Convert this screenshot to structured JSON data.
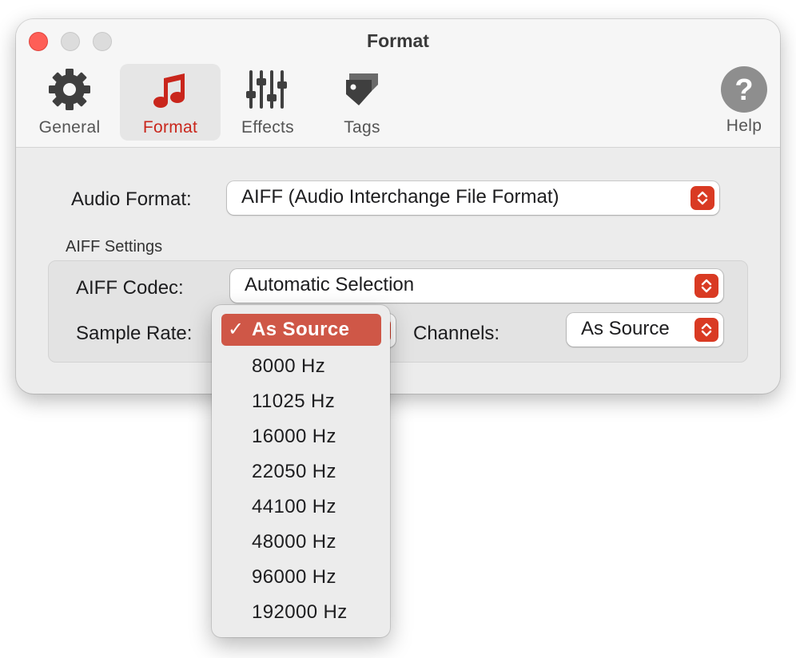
{
  "window": {
    "title": "Format"
  },
  "toolbar": {
    "items": [
      {
        "label": "General",
        "icon": "gear-icon"
      },
      {
        "label": "Format",
        "icon": "music-note-icon"
      },
      {
        "label": "Effects",
        "icon": "sliders-icon"
      },
      {
        "label": "Tags",
        "icon": "tag-icon"
      }
    ],
    "help": {
      "label": "Help",
      "icon": "question-icon",
      "glyph": "?"
    }
  },
  "content": {
    "audio_format": {
      "label": "Audio Format:",
      "value": "AIFF (Audio Interchange File Format)"
    },
    "group_title": "AIFF Settings",
    "codec": {
      "label": "AIFF Codec:",
      "value": "Automatic Selection"
    },
    "sample_rate": {
      "label": "Sample Rate:"
    },
    "channels": {
      "label": "Channels:",
      "value": "As Source"
    }
  },
  "sample_rate_menu": {
    "check": "✓",
    "selected_index": 0,
    "options": [
      "As Source",
      "8000 Hz",
      "11025 Hz",
      "16000 Hz",
      "22050 Hz",
      "44100 Hz",
      "48000 Hz",
      "96000 Hz",
      "192000 Hz"
    ]
  },
  "colors": {
    "accent": "#c9261c",
    "stepper": "#d93a23",
    "menu_selected": "#cf5747",
    "close": "#fe5f57"
  }
}
